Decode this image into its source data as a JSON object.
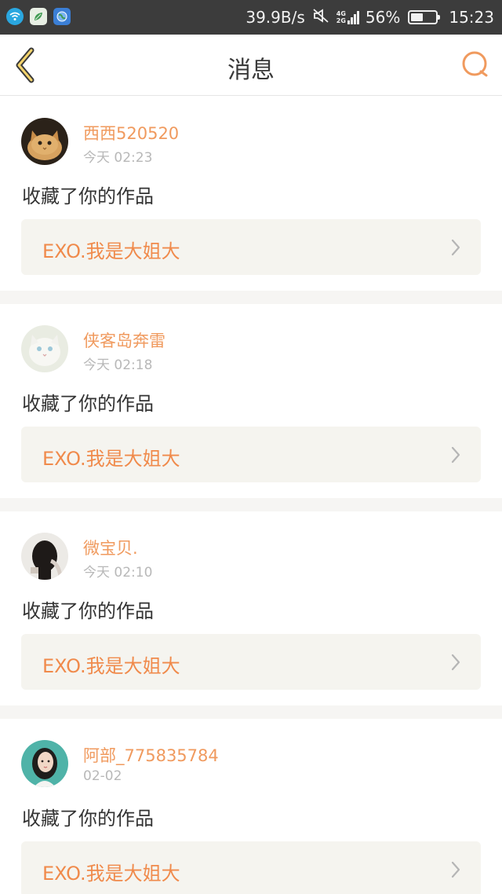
{
  "status_bar": {
    "net_speed": "39.9B/s",
    "network_labels": [
      "4G",
      "2G"
    ],
    "battery_percent": "56%",
    "battery_level": 0.56,
    "time": "15:23",
    "icons": [
      "wifi-app-icon",
      "leaf-app-icon",
      "globe-app-icon",
      "mute-icon",
      "signal-icon",
      "battery-icon"
    ]
  },
  "header": {
    "title": "消息",
    "back_icon": "chevron-left-icon",
    "search_icon": "search-icon",
    "accent_color": "#f09a5e"
  },
  "notifications": [
    {
      "username": "西西520520",
      "time": "今天 02:23",
      "action": "收藏了你的作品",
      "work_title": "EXO.我是大姐大",
      "avatar": "cat-avatar"
    },
    {
      "username": "侠客岛奔雷",
      "time": "今天 02:18",
      "action": "收藏了你的作品",
      "work_title": "EXO.我是大姐大",
      "avatar": "white-cat-avatar"
    },
    {
      "username": "微宝贝.",
      "time": "今天 02:10",
      "action": "收藏了你的作品",
      "work_title": "EXO.我是大姐大",
      "avatar": "girl-back-avatar"
    },
    {
      "username": "阿部_775835784",
      "time": "02-02",
      "action": "收藏了你的作品",
      "work_title": "EXO.我是大姐大",
      "avatar": "girl-portrait-avatar"
    }
  ]
}
